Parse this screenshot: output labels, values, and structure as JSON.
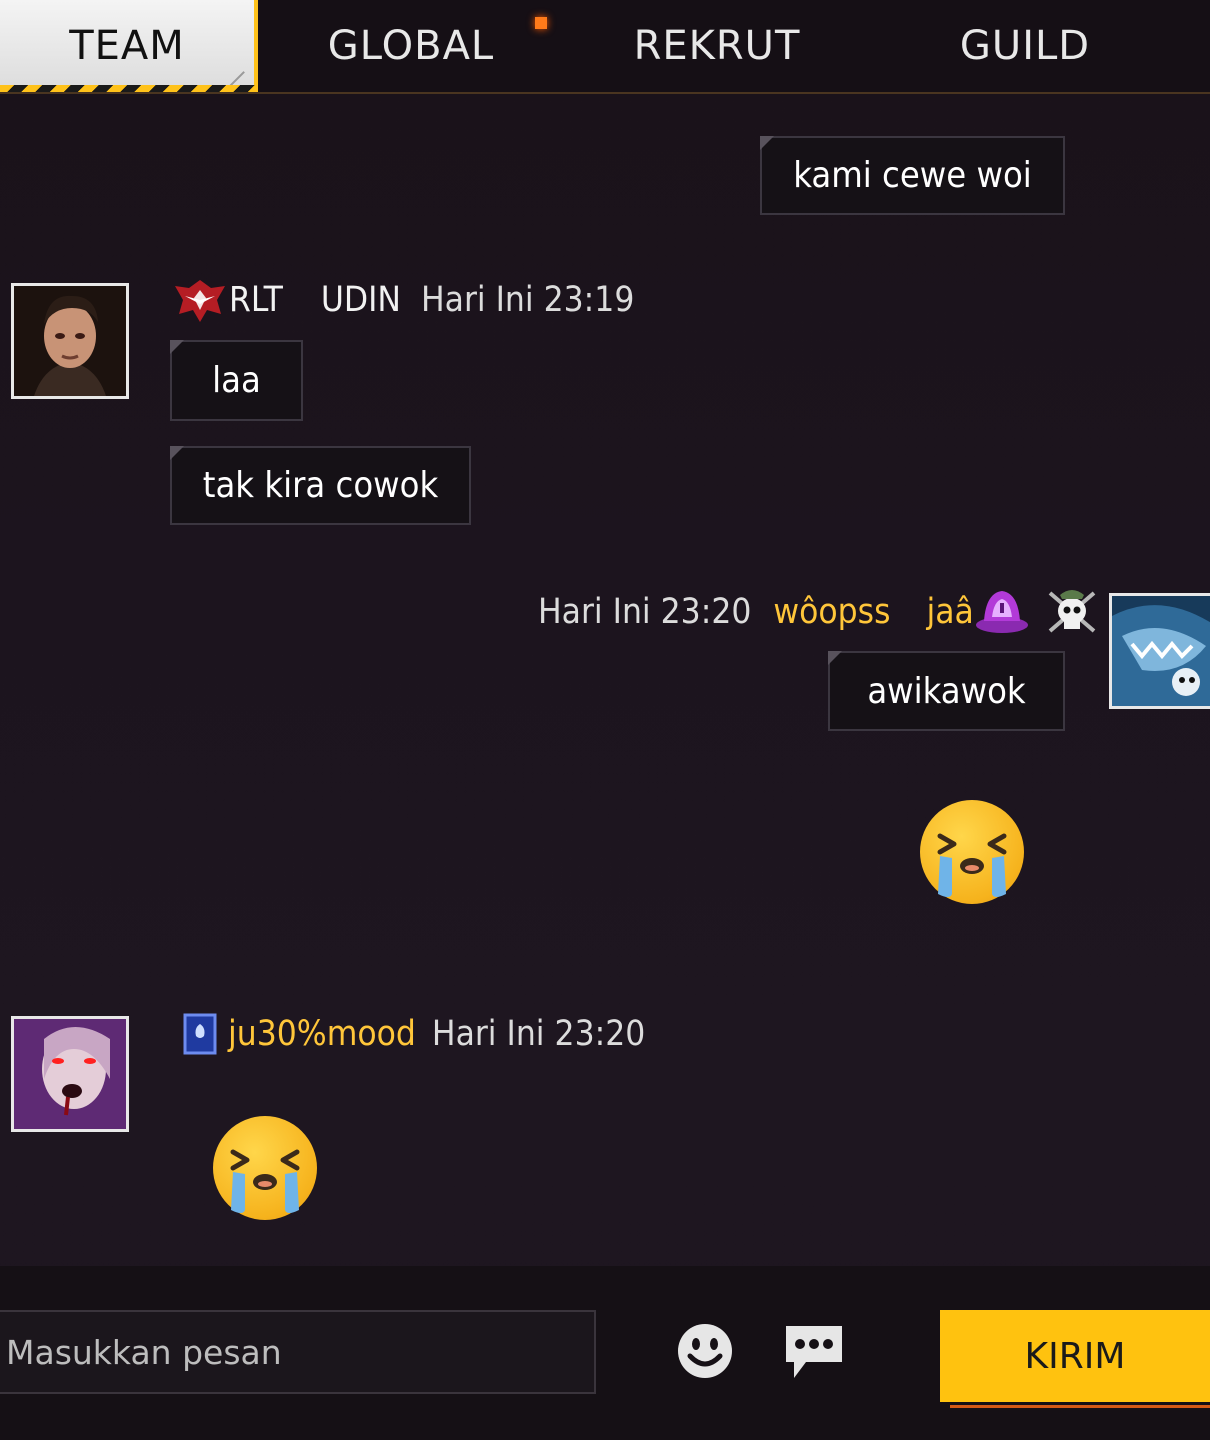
{
  "tabs": [
    {
      "label": "TEAM",
      "active": true
    },
    {
      "label": "GLOBAL",
      "active": false,
      "notification": true
    },
    {
      "label": "REKRUT",
      "active": false
    },
    {
      "label": "GUILD",
      "active": false
    }
  ],
  "messages": [
    {
      "side": "right",
      "text": "kami cewe woi"
    },
    {
      "side": "left",
      "guild_tag": "RLT",
      "user": "UDIN",
      "time": "Hari Ini 23:19",
      "bubbles": [
        "laa",
        "tak kira cowok"
      ],
      "avatar": "male-character-avatar"
    },
    {
      "side": "right",
      "time": "Hari Ini 23:20",
      "user_gold": "wôopss",
      "user_gold2": "jaâ",
      "bubbles": [
        "awikawok"
      ],
      "emoji": "loudly-crying-emoji",
      "avatar": "shark-avatar"
    },
    {
      "side": "left",
      "user": "ju30%mood",
      "time": "Hari Ini 23:20",
      "emoji": "loudly-crying-emoji",
      "avatar": "vampire-avatar"
    }
  ],
  "composer": {
    "placeholder": "Masukkan pesan",
    "send_label": "KIRIM"
  },
  "colors": {
    "accent": "#ffc20f",
    "username_gold": "#ffc63a",
    "bubble_bg": "#151116"
  }
}
